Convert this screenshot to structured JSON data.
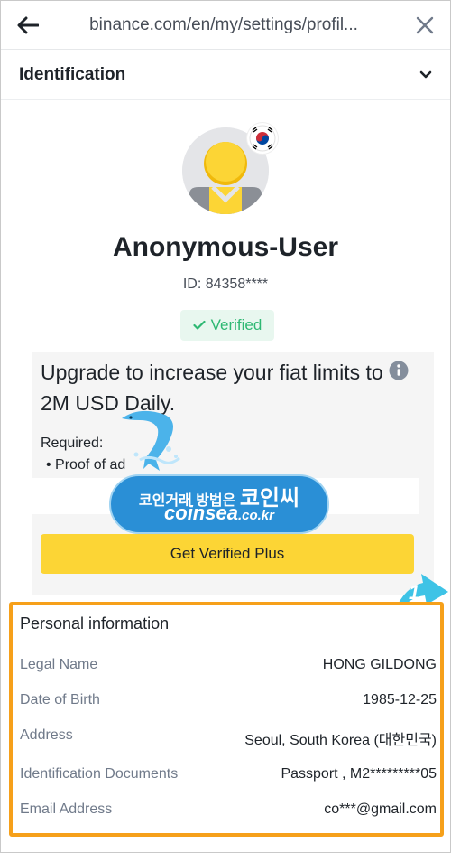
{
  "browser": {
    "url": "binance.com/en/my/settings/profil...",
    "back_icon": "arrow-left-icon",
    "close_icon": "close-icon"
  },
  "section": {
    "title": "Identification",
    "chevron_icon": "chevron-down-icon"
  },
  "profile": {
    "flag_icon": "south-korea-flag-icon",
    "username": "Anonymous-User",
    "id_text": "ID: 84358****",
    "verified_label": "Verified",
    "verified_color": "#2eb873"
  },
  "upgrade": {
    "title": "Upgrade to increase your fiat limits to 2M USD Daily.",
    "required_label": "Required:",
    "required_item": "Proof of ad",
    "button_label": "Get Verified Plus",
    "button_color": "#fcd535"
  },
  "watermark": {
    "korean": "코인거래 방법은",
    "brand": "코인씨",
    "domain": "coinsea",
    "domain_suffix": ".co.kr"
  },
  "marker": {
    "number": "1",
    "color": "#3ec3e6"
  },
  "personal": {
    "title": "Personal information",
    "highlight_color": "#f6a01a",
    "rows": [
      {
        "label": "Legal Name",
        "value": "HONG GILDONG"
      },
      {
        "label": "Date of Birth",
        "value": "1985-12-25"
      },
      {
        "label": "Address",
        "value": "Seoul, South Korea (대한민국)"
      },
      {
        "label": "Identification Documents",
        "value": "Passport , M2*********05"
      },
      {
        "label": "Email Address",
        "value": "co***@gmail.com"
      }
    ]
  }
}
